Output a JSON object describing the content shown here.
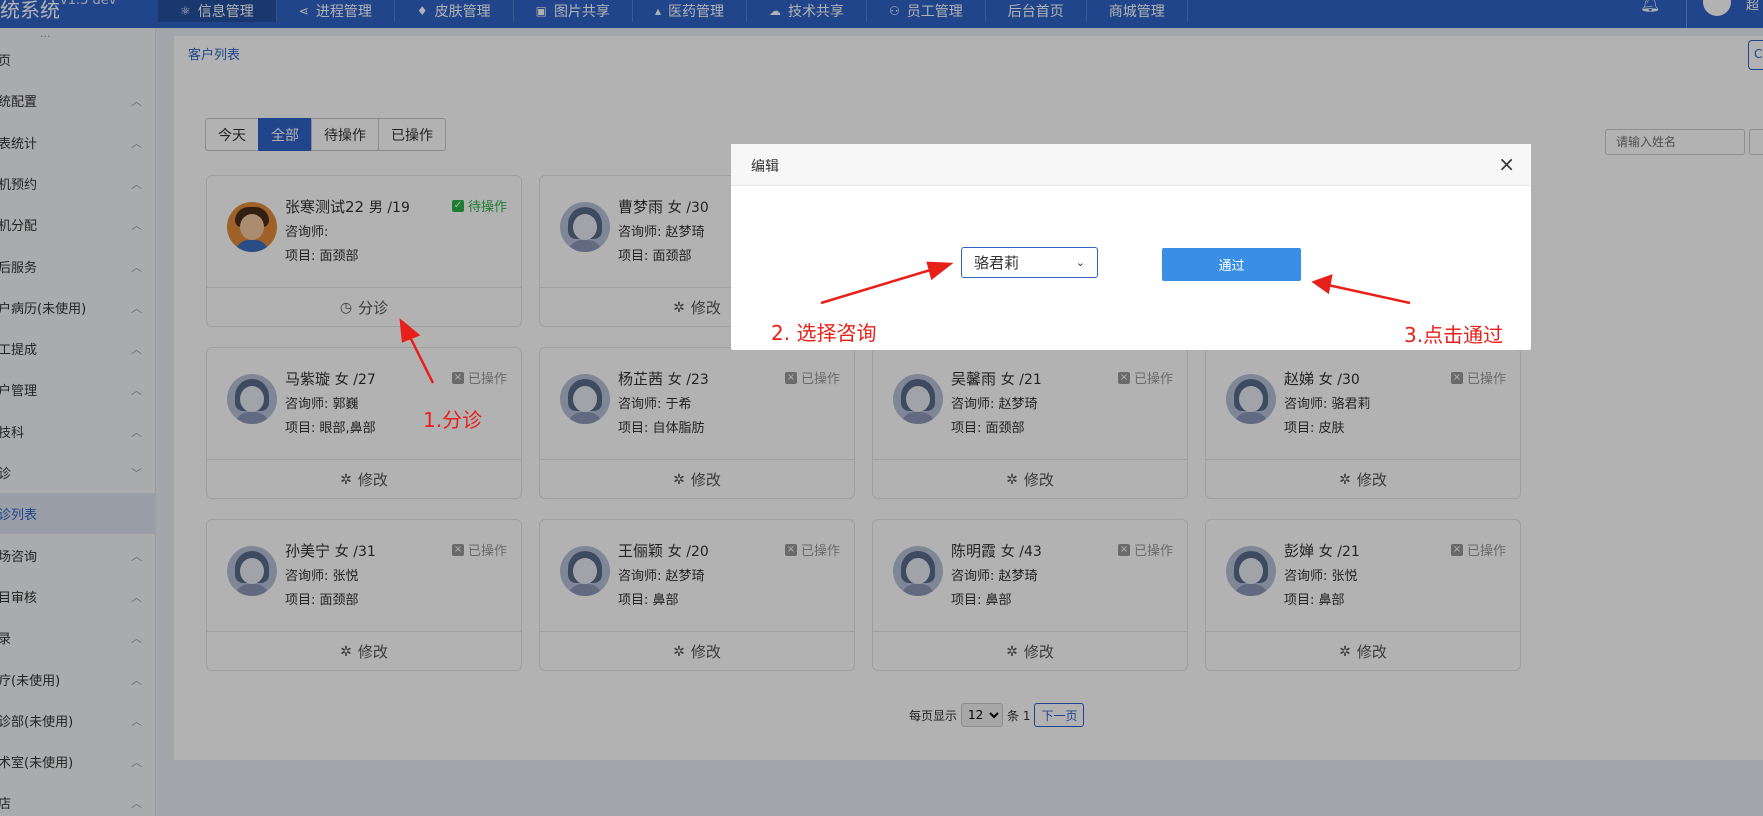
{
  "topbar": {
    "brand": "统系统",
    "version": "v1.3 dev",
    "nav": [
      {
        "icon": "⚛",
        "label": "信息管理",
        "active": true
      },
      {
        "icon": "⋖",
        "label": "进程管理"
      },
      {
        "icon": "♦",
        "label": "皮肤管理"
      },
      {
        "icon": "▣",
        "label": "图片共享"
      },
      {
        "icon": "▴",
        "label": "医药管理"
      },
      {
        "icon": "☁",
        "label": "技术共享"
      },
      {
        "icon": "⚇",
        "label": "员工管理"
      },
      {
        "icon": "",
        "label": "后台首页"
      },
      {
        "icon": "",
        "label": "商城管理"
      }
    ],
    "user_glyph": "超"
  },
  "sidebar": {
    "dots": "···",
    "items": [
      {
        "label": "页",
        "chev": ""
      },
      {
        "label": "统配置",
        "chev": "︿"
      },
      {
        "label": "表统计",
        "chev": "︿"
      },
      {
        "label": "机预约",
        "chev": "︿"
      },
      {
        "label": "机分配",
        "chev": "︿"
      },
      {
        "label": "后服务",
        "chev": "︿"
      },
      {
        "label": "户病历(未使用)",
        "chev": "︿"
      },
      {
        "label": "工提成",
        "chev": "︿"
      },
      {
        "label": "户管理",
        "chev": "︿"
      },
      {
        "label": "技科",
        "chev": "︿"
      },
      {
        "label": "诊",
        "chev": "﹀"
      },
      {
        "label": "诊列表",
        "chev": "",
        "active": true
      },
      {
        "label": "场咨询",
        "chev": "︿"
      },
      {
        "label": "目审核",
        "chev": "︿"
      },
      {
        "label": "录",
        "chev": "︿"
      },
      {
        "label": "疗(未使用)",
        "chev": "︿"
      },
      {
        "label": "诊部(未使用)",
        "chev": "︿"
      },
      {
        "label": "术室(未使用)",
        "chev": "︿"
      },
      {
        "label": "店",
        "chev": "︿"
      }
    ]
  },
  "breadcrumb": "客户列表",
  "crumb_btn": "C",
  "filters": [
    {
      "label": "今天"
    },
    {
      "label": "全部",
      "active": true
    },
    {
      "label": "待操作"
    },
    {
      "label": "已操作"
    }
  ],
  "search": {
    "placeholder": "请输入姓名"
  },
  "cards": [
    {
      "name": "张寒测试22",
      "meta": "男 /19",
      "consultant": "咨询师:",
      "project": "项目: 面颈部",
      "status": "待操作",
      "pending": true,
      "boy": true,
      "action": "分诊",
      "action_icon": "◷"
    },
    {
      "name": "曹梦雨",
      "meta": "女 /30",
      "consultant": "咨询师: 赵梦琦",
      "project": "项目: 面颈部",
      "status": "",
      "action": "修改",
      "action_icon": "✲"
    },
    {
      "name": "马紫璇",
      "meta": "女 /27",
      "consultant": "咨询师: 郭巍",
      "project": "项目: 眼部,鼻部",
      "status": "已操作",
      "action": "修改",
      "action_icon": "✲"
    },
    {
      "name": "杨芷茜",
      "meta": "女 /23",
      "consultant": "咨询师: 于希",
      "project": "项目: 自体脂肪",
      "status": "已操作",
      "action": "修改",
      "action_icon": "✲"
    },
    {
      "name": "吴馨雨",
      "meta": "女 /21",
      "consultant": "咨询师: 赵梦琦",
      "project": "项目: 面颈部",
      "status": "已操作",
      "action": "修改",
      "action_icon": "✲"
    },
    {
      "name": "赵娣",
      "meta": "女 /30",
      "consultant": "咨询师: 骆君莉",
      "project": "项目: 皮肤",
      "status": "已操作",
      "action": "修改",
      "action_icon": "✲"
    },
    {
      "name": "孙美宁",
      "meta": "女 /31",
      "consultant": "咨询师: 张悦",
      "project": "项目: 面颈部",
      "status": "已操作",
      "action": "修改",
      "action_icon": "✲"
    },
    {
      "name": "王俪颖",
      "meta": "女 /20",
      "consultant": "咨询师: 赵梦琦",
      "project": "项目: 鼻部",
      "status": "已操作",
      "action": "修改",
      "action_icon": "✲"
    },
    {
      "name": "陈明霞",
      "meta": "女 /43",
      "consultant": "咨询师: 赵梦琦",
      "project": "项目: 鼻部",
      "status": "已操作",
      "action": "修改",
      "action_icon": "✲"
    },
    {
      "name": "彭婵",
      "meta": "女 /21",
      "consultant": "咨询师: 张悦",
      "project": "项目: 鼻部",
      "status": "已操作",
      "action": "修改",
      "action_icon": "✲"
    }
  ],
  "pager": {
    "per_page_label": "每页显示",
    "per_page_value": "12",
    "count_label": "条 1",
    "next": "下一页"
  },
  "modal": {
    "title": "编辑",
    "close": "×",
    "select_value": "骆君莉",
    "select_caret": "⌄",
    "button": "通过"
  },
  "annotations": {
    "step1": "1.分诊",
    "step2": "2. 选择咨询",
    "step3": "3.点击通过"
  },
  "colors": {
    "primary": "#2f63c7",
    "annotation": "#e8201a",
    "pending": "#2db34a",
    "button": "#3a8ee6"
  }
}
